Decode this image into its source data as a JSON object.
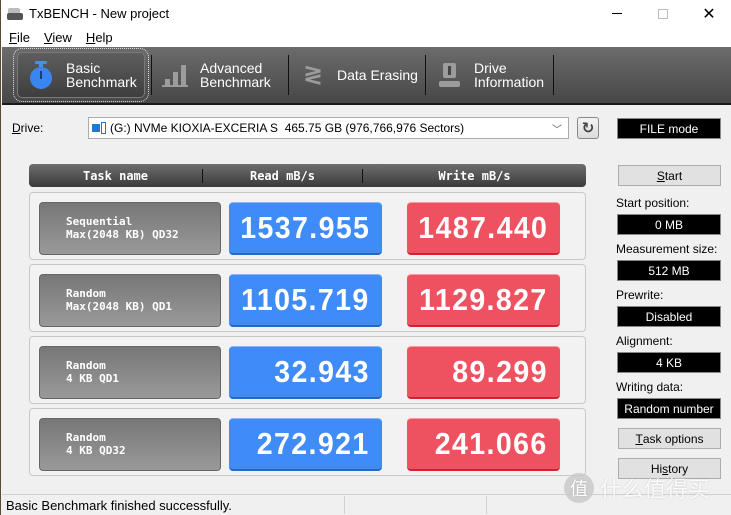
{
  "window": {
    "title": "TxBENCH - New project",
    "controls": {
      "minimize": "—",
      "maximize": "☐",
      "close": "✕"
    }
  },
  "menu": [
    {
      "label": "File",
      "accel": "F",
      "rest": "ile"
    },
    {
      "label": "View",
      "accel": "V",
      "rest": "iew"
    },
    {
      "label": "Help",
      "accel": "H",
      "rest": "elp"
    }
  ],
  "tabs": [
    {
      "label": "Basic\nBenchmark",
      "icon": "stopwatch-icon",
      "active": true
    },
    {
      "label": "Advanced\nBenchmark",
      "icon": "bar-chart-icon",
      "active": false
    },
    {
      "label": "Data Erasing",
      "icon": "eraser-icon",
      "active": false
    },
    {
      "label": "Drive\nInformation",
      "icon": "drive-info-icon",
      "active": false
    }
  ],
  "drive": {
    "label_accel": "D",
    "label_rest": "rive:",
    "selected": "(G:) NVMe KIOXIA-EXCERIA S  465.75 GB (976,766,976 Sectors)",
    "mode": "FILE mode"
  },
  "table": {
    "headers": [
      "Task name",
      "Read mB/s",
      "Write mB/s"
    ],
    "rows": [
      {
        "task": "Sequential\nMax(2048 KB) QD32",
        "read": "1537.955",
        "write": "1487.440"
      },
      {
        "task": "Random\nMax(2048 KB) QD1",
        "read": "1105.719",
        "write": "1129.827"
      },
      {
        "task": "Random\n4 KB QD1",
        "read": "32.943",
        "write": "89.299"
      },
      {
        "task": "Random\n4 KB QD32",
        "read": "272.921",
        "write": "241.066"
      }
    ]
  },
  "panel": {
    "start": {
      "accel": "S",
      "rest": "tart"
    },
    "start_position_label": "Start position:",
    "start_position": "0 MB",
    "measurement_size_label": "Measurement size:",
    "measurement_size": "512 MB",
    "prewrite_label": "Prewrite:",
    "prewrite": "Disabled",
    "alignment_label": "Alignment:",
    "alignment": "4 KB",
    "writing_data_label": "Writing data:",
    "writing_data": "Random number",
    "task_options": {
      "accel": "T",
      "rest": "ask options"
    },
    "history": {
      "pre": "Hi",
      "accel": "s",
      "rest": "tory"
    }
  },
  "status": {
    "text": "Basic Benchmark finished successfully."
  },
  "watermark": {
    "badge": "值",
    "text": "什么值得买"
  },
  "colors": {
    "read": "#3f8bf7",
    "write": "#ee5260",
    "task": "#888888"
  }
}
